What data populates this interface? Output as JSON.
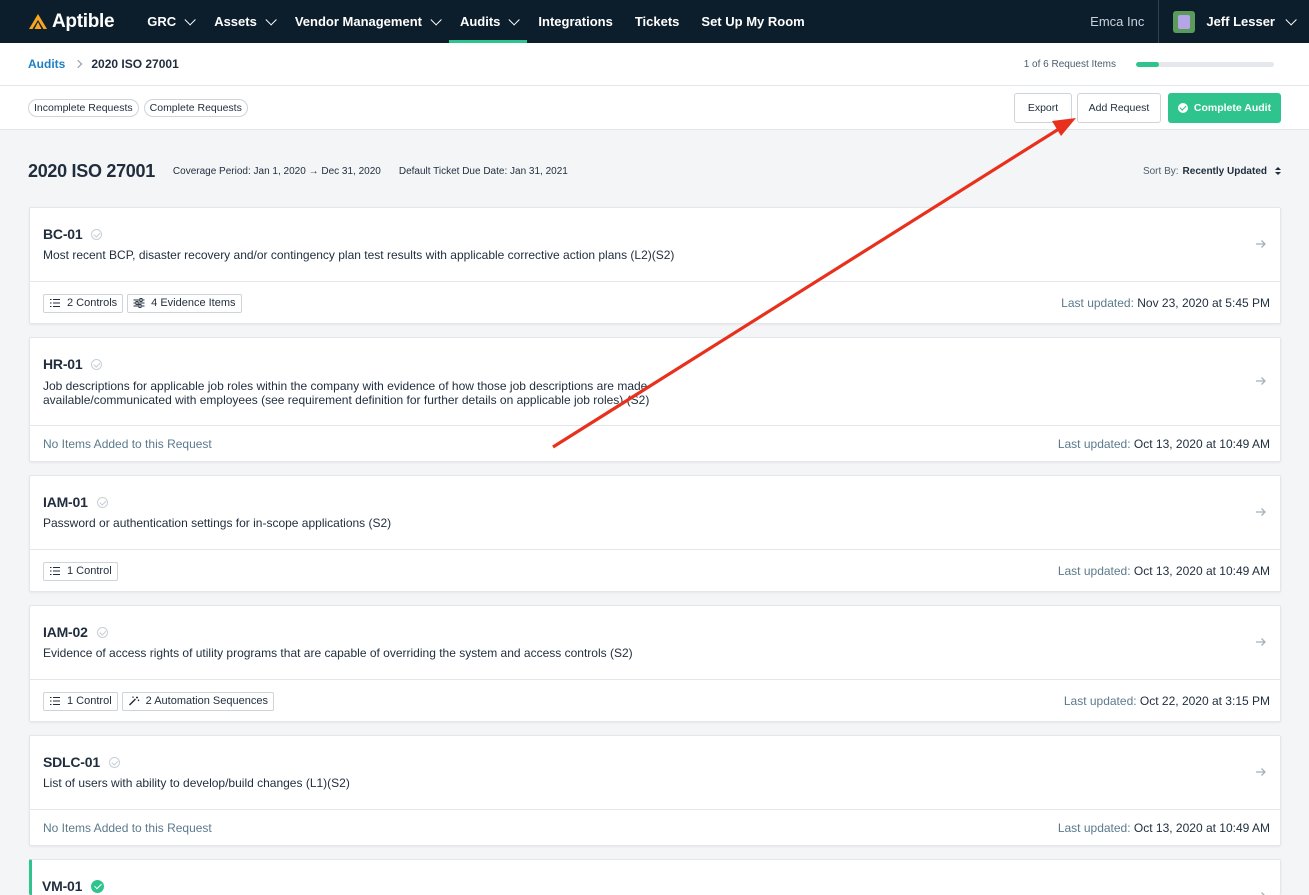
{
  "brand": {
    "name": "Aptible",
    "accent": "#2fc48d",
    "nav_bg": "#0c1e2c",
    "link": "#1f7fc4"
  },
  "nav": {
    "items": [
      {
        "label": "GRC",
        "has_dropdown": true,
        "active": false
      },
      {
        "label": "Assets",
        "has_dropdown": true,
        "active": false
      },
      {
        "label": "Vendor Management",
        "has_dropdown": true,
        "active": false
      },
      {
        "label": "Audits",
        "has_dropdown": true,
        "active": true
      },
      {
        "label": "Integrations",
        "has_dropdown": false,
        "active": false
      },
      {
        "label": "Tickets",
        "has_dropdown": false,
        "active": false
      },
      {
        "label": "Set Up My Room",
        "has_dropdown": false,
        "active": false
      }
    ],
    "org": "Emca Inc",
    "user": "Jeff Lesser"
  },
  "breadcrumb": {
    "parent": "Audits",
    "current": "2020 ISO 27001"
  },
  "progress": {
    "text": "1 of 6 Request Items",
    "fraction": 0.167
  },
  "filters": [
    "Incomplete Requests",
    "Complete Requests"
  ],
  "actions": {
    "export": "Export",
    "add_request": "Add Request",
    "complete_audit": "Complete Audit"
  },
  "header": {
    "title": "2020 ISO 27001",
    "coverage": "Coverage Period: Jan 1, 2020 → Dec 31, 2020",
    "due_date": "Default Ticket Due Date: Jan 31, 2021",
    "sort_label": "Sort By:",
    "sort_value": "Recently Updated"
  },
  "requests": [
    {
      "id": "BC-01",
      "complete": false,
      "description": "Most recent BCP, disaster recovery and/or contingency plan test results with applicable corrective action plans (L2)(S2)",
      "tags": [
        {
          "icon": "list-icon",
          "label": "2 Controls"
        },
        {
          "icon": "sliders-icon",
          "label": "4 Evidence Items"
        }
      ],
      "empty_text": "",
      "updated_label": "Last updated:",
      "updated_at": "Nov 23, 2020 at 5:45 PM"
    },
    {
      "id": "HR-01",
      "complete": false,
      "description": "Job descriptions for applicable job roles within the company with evidence of how those job descriptions are made available/communicated with employees (see requirement definition for further details on applicable job roles) (S2)",
      "tags": [],
      "empty_text": "No Items Added to this Request",
      "updated_label": "Last updated:",
      "updated_at": "Oct 13, 2020 at 10:49 AM"
    },
    {
      "id": "IAM-01",
      "complete": false,
      "description": "Password or authentication settings for in-scope applications (S2)",
      "tags": [
        {
          "icon": "list-icon",
          "label": "1 Control"
        }
      ],
      "empty_text": "",
      "updated_label": "Last updated:",
      "updated_at": "Oct 13, 2020 at 10:49 AM"
    },
    {
      "id": "IAM-02",
      "complete": false,
      "description": "Evidence of access rights of utility programs that are capable of overriding the system and access controls (S2)",
      "tags": [
        {
          "icon": "list-icon",
          "label": "1 Control"
        },
        {
          "icon": "magic-wand-icon",
          "label": "2 Automation Sequences"
        }
      ],
      "empty_text": "",
      "updated_label": "Last updated:",
      "updated_at": "Oct 22, 2020 at 3:15 PM"
    },
    {
      "id": "SDLC-01",
      "complete": false,
      "description": "List of users with ability to develop/build changes (L1)(S2)",
      "tags": [],
      "empty_text": "No Items Added to this Request",
      "updated_label": "Last updated:",
      "updated_at": "Oct 13, 2020 at 10:49 AM"
    },
    {
      "id": "VM-01",
      "complete": true,
      "description": "",
      "tags": [],
      "empty_text": "",
      "updated_label": "",
      "updated_at": ""
    }
  ],
  "annotation": {
    "color": "#e8301c",
    "icon": "red-arrow-annotation"
  }
}
